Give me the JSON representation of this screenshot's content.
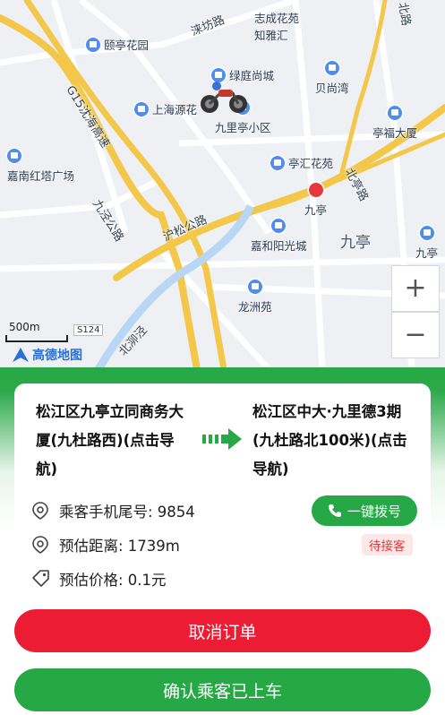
{
  "map": {
    "pois": [
      {
        "key": "yiting",
        "label": "颐亭花园"
      },
      {
        "key": "zhicheng",
        "label": "志成花苑"
      },
      {
        "key": "zhijing",
        "label": "知雅汇"
      },
      {
        "key": "lvting",
        "label": "绿庭尚城"
      },
      {
        "key": "beishang",
        "label": "贝尚湾"
      },
      {
        "key": "shanghai",
        "label": "上海源花"
      },
      {
        "key": "jiuliting",
        "label": "九里亭小区"
      },
      {
        "key": "tingfu",
        "label": "亭福大厦"
      },
      {
        "key": "jianan",
        "label": "嘉南红塔广场"
      },
      {
        "key": "tinghui",
        "label": "亭汇花苑"
      },
      {
        "key": "jiuting_stn",
        "label": "九亭"
      },
      {
        "key": "jiahe",
        "label": "嘉和阳光城"
      },
      {
        "key": "longzhou",
        "label": "龙洲苑"
      }
    ],
    "roads": {
      "zhufang": "涞坊路",
      "g15": "G15沈海高速",
      "jiujing": "九泾公路",
      "husong": "沪松公路",
      "beishuang": "北亭路",
      "jiuting_road": "九亭",
      "bei_he": "北泖泾",
      "north_road": "北路",
      "s124": "S124"
    },
    "areas": {
      "jiuting": "九亭",
      "jiuting2": "九亭"
    },
    "scale": "500m",
    "logo": "高德地图",
    "zoom_in": "+",
    "zoom_out": "−"
  },
  "route": {
    "from": "松江区九亭立同商务大厦(九杜路西)(点击导航)",
    "to": "松江区中大·九里德3期(九杜路北100米)(点击导航)"
  },
  "info": {
    "phone_label": "乘客手机尾号: 9854",
    "distance_label": "预估距离: 1739m",
    "price_label": "预估价格: 0.1元"
  },
  "call_button": "一键拨号",
  "status_badge": "待接客",
  "buttons": {
    "cancel": "取消订单",
    "confirm": "确认乘客已上车"
  },
  "colors": {
    "primary_green": "#27a846",
    "cancel_red": "#ec1c35",
    "badge_red": "#e5383b"
  }
}
